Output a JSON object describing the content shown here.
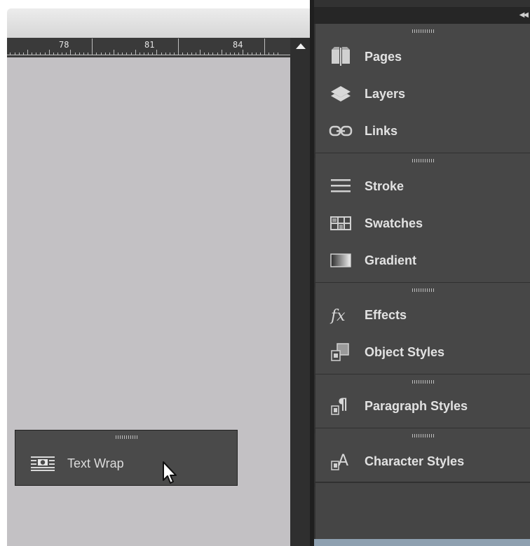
{
  "ruler": {
    "labels": [
      "78",
      "81",
      "84"
    ]
  },
  "text_wrap_panel": {
    "label": "Text Wrap",
    "icon": "text-wrap-icon"
  },
  "dock": {
    "groups": [
      {
        "items": [
          {
            "label": "Pages",
            "icon": "pages-icon"
          },
          {
            "label": "Layers",
            "icon": "layers-icon"
          },
          {
            "label": "Links",
            "icon": "links-icon"
          }
        ]
      },
      {
        "items": [
          {
            "label": "Stroke",
            "icon": "stroke-icon"
          },
          {
            "label": "Swatches",
            "icon": "swatches-icon"
          },
          {
            "label": "Gradient",
            "icon": "gradient-icon"
          }
        ]
      },
      {
        "items": [
          {
            "label": "Effects",
            "icon": "effects-icon"
          },
          {
            "label": "Object Styles",
            "icon": "object-styles-icon"
          }
        ]
      },
      {
        "items": [
          {
            "label": "Paragraph Styles",
            "icon": "paragraph-styles-icon"
          }
        ]
      },
      {
        "items": [
          {
            "label": "Character Styles",
            "icon": "character-styles-icon"
          }
        ]
      }
    ]
  },
  "colors": {
    "panel_bg": "#474747",
    "canvas_bg": "#c3c1c4",
    "label_text": "#e2e2e2"
  }
}
